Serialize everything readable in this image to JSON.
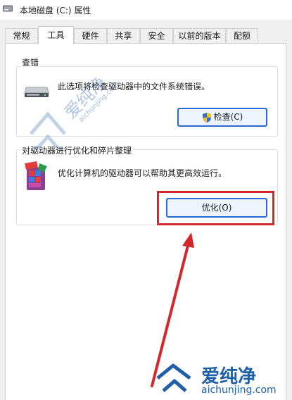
{
  "window": {
    "title": "本地磁盘 (C:) 属性"
  },
  "tabs": [
    {
      "label": "常规",
      "active": false
    },
    {
      "label": "工具",
      "active": true
    },
    {
      "label": "硬件",
      "active": false
    },
    {
      "label": "共享",
      "active": false
    },
    {
      "label": "安全",
      "active": false
    },
    {
      "label": "以前的版本",
      "active": false
    },
    {
      "label": "配额",
      "active": false
    }
  ],
  "error_check": {
    "title": "查错",
    "description": "此选项将检查驱动器中的文件系统错误。",
    "button_label": "检查(C)",
    "icon": "hard-drive-icon",
    "button_icon": "uac-shield-icon"
  },
  "optimize": {
    "title": "对驱动器进行优化和碎片整理",
    "description": "优化计算机的驱动器可以帮助其更高效运行。",
    "button_label": "优化(O)",
    "icon": "defrag-icon"
  },
  "annotation": {
    "color": "#d3282b",
    "shapes": [
      "highlight-box",
      "arrow"
    ]
  },
  "watermark": {
    "brand": "爱纯净",
    "url": "aichunjing.com",
    "color": "#1f5fa8"
  }
}
